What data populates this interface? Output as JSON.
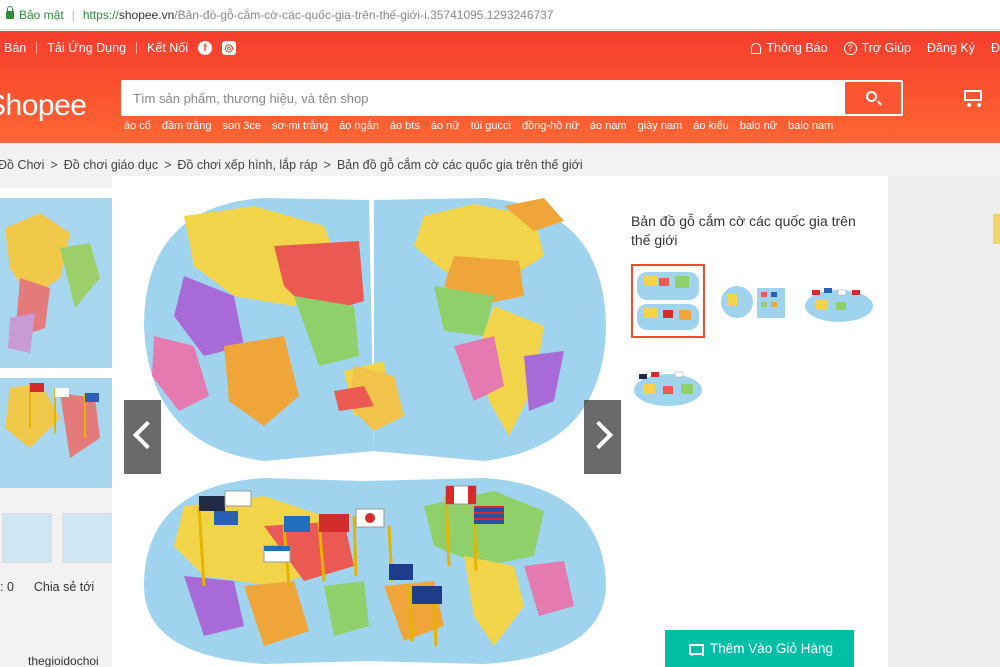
{
  "browser": {
    "secure_label": "Bảo mật",
    "url_scheme": "https://",
    "url_host": "shopee.vn",
    "url_path": "/Bản-đồ-gỗ-cắm-cờ-các-quốc-gia-trên-thế-giới-i.35741095.1293246737"
  },
  "header": {
    "nav_left": [
      "Bán",
      "Tải Ứng Dụng",
      "Kết Nối"
    ],
    "nav_right": {
      "notifications": "Thông Báo",
      "help": "Trợ Giúp",
      "register": "Đăng Ký"
    },
    "logo": "Shopee",
    "search_placeholder": "Tìm sản phẩm, thương hiệu, và tên shop",
    "suggest_tags": [
      "áo cổ",
      "đầm trắng",
      "son 3ce",
      "sơ-mi trắng",
      "áo ngắn",
      "áo bts",
      "áo nữ",
      "túi gucci",
      "đồng-hồ nữ",
      "áo nam",
      "giày nam",
      "áo kiểu",
      "balo nữ",
      "balo nam"
    ]
  },
  "breadcrumb": [
    "Đồ Chơi",
    "Đồ chơi giáo dục",
    "Đồ chơi xếp hình, lắp ráp",
    "Bản đồ gỗ cắm cờ các quốc gia trên thế giới"
  ],
  "breadcrumb_sep": ">",
  "page": {
    "likes": ": 0",
    "share": "Chia sẻ tới",
    "shop_name": "thegioidochoi"
  },
  "modal": {
    "product_title": "Bản đồ gỗ cắm cờ các quốc gia trên thế giới",
    "add_to_cart": "Thêm Vào Giỏ Hàng",
    "thumbnail_count": 4,
    "active_thumbnail": 1
  },
  "colors": {
    "brand": "#ee4d2d",
    "ocean": "#9fd3ee",
    "cart_button": "#00bfa5"
  }
}
